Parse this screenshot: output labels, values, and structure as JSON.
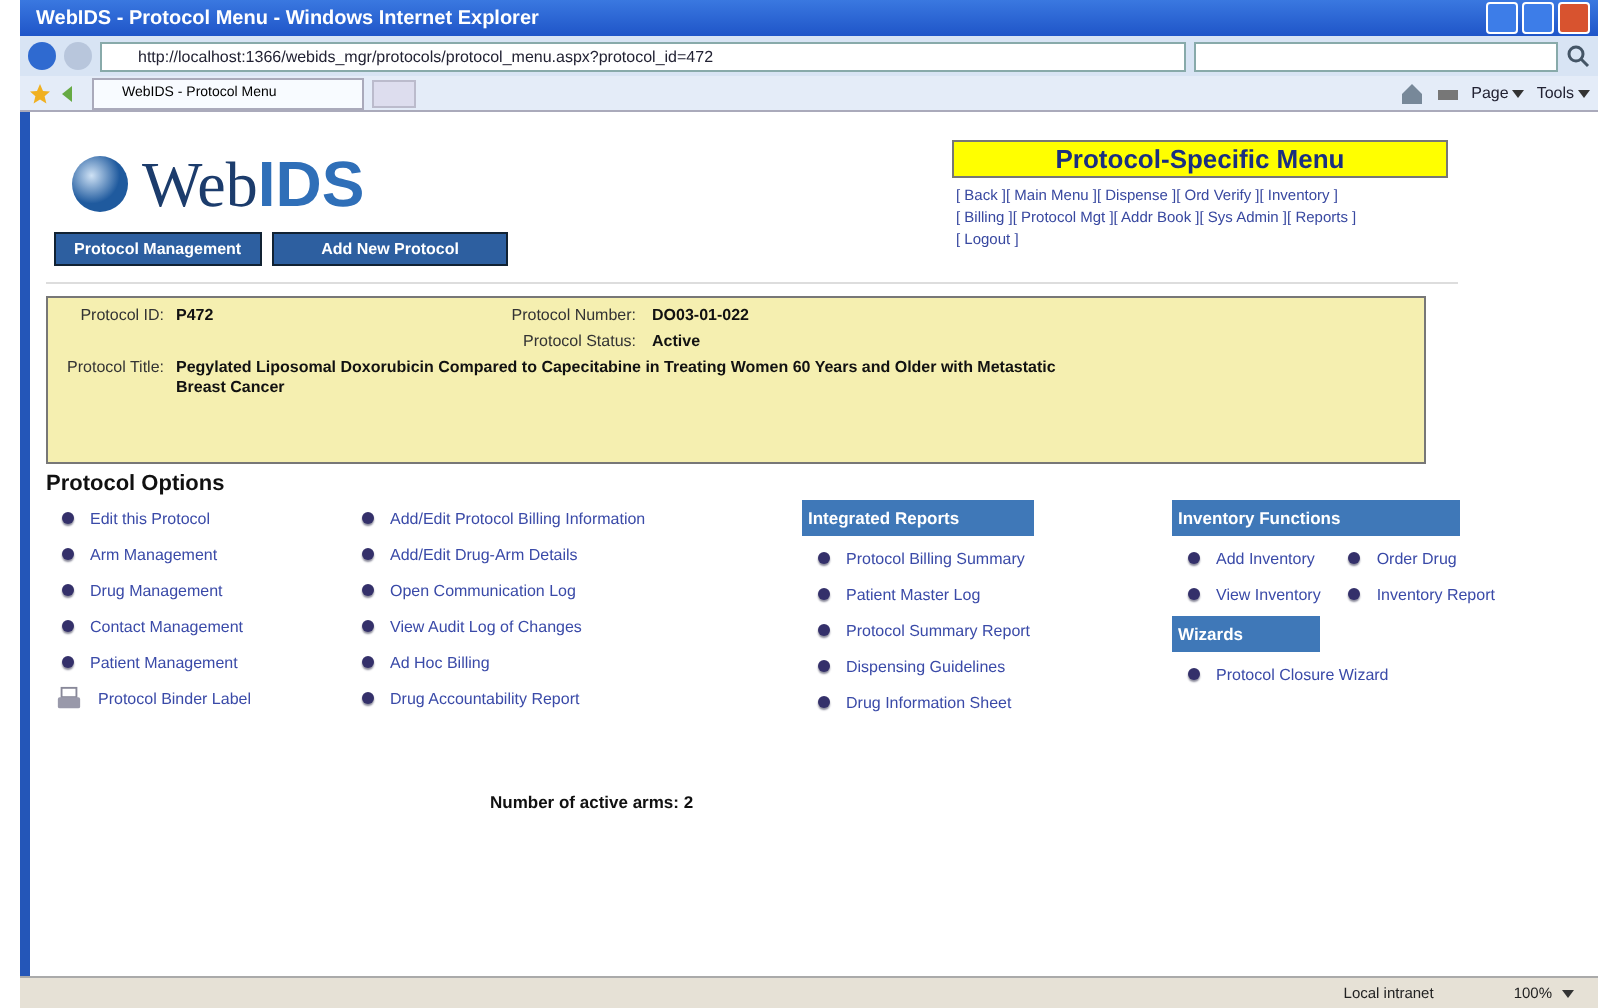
{
  "window": {
    "title": "WebIDS - Protocol Menu - Windows Internet Explorer"
  },
  "address_bar": {
    "url": "http://localhost:1366/webids_mgr/protocols/protocol_menu.aspx?protocol_id=472"
  },
  "browser_tab": {
    "title": "WebIDS - Protocol Menu"
  },
  "toolbar": [
    "Page",
    "Tools"
  ],
  "logo": {
    "light": "Web",
    "bold": "IDS"
  },
  "nav_buttons": [
    "Protocol Management",
    "Add New Protocol"
  ],
  "protocol_menu": {
    "title": "Protocol-Specific Menu",
    "links": [
      "[ Back ]",
      "[ Main Menu ]",
      "[ Dispense ]",
      "[ Ord Verify ]",
      "[ Inventory ]",
      "[ Billing ]",
      "[ Protocol Mgt ]",
      "[ Addr Book ]",
      "[ Sys Admin ]",
      "[ Reports ]",
      "[ Logout ]"
    ]
  },
  "protocol_info": {
    "id_label": "Protocol ID:",
    "id": "P472",
    "number_label": "Protocol Number:",
    "number": "DO03-01-022",
    "status_label": "Protocol Status:",
    "status": "Active",
    "title_label": "Protocol Title:",
    "title": "Pegylated Liposomal Doxorubicin Compared to Capecitabine in Treating Women 60 Years and Older with Metastatic Breast Cancer"
  },
  "options_heading": "Protocol Options",
  "options_column_1": [
    {
      "label": "Edit this Protocol",
      "kind": "bullet"
    },
    {
      "label": "Arm Management",
      "kind": "bullet"
    },
    {
      "label": "Drug Management",
      "kind": "bullet"
    },
    {
      "label": "Contact Management",
      "kind": "bullet"
    },
    {
      "label": "Patient Management",
      "kind": "bullet"
    },
    {
      "label": "Protocol Binder Label",
      "kind": "printer"
    }
  ],
  "options_column_2": [
    "Add/Edit Protocol Billing Information",
    "Add/Edit Drug-Arm Details",
    "Open Communication Log",
    "View Audit Log of Changes",
    "Ad Hoc Billing",
    "Drug Accountability Report"
  ],
  "integrated_reports": {
    "title": "Integrated Reports",
    "links": [
      "Protocol Billing Summary",
      "Patient Master Log",
      "Protocol Summary Report",
      "Dispensing Guidelines",
      "Drug Information Sheet"
    ]
  },
  "inventory_functions": {
    "title": "Inventory Functions",
    "links": [
      "Add Inventory",
      "Order Drug",
      "View Inventory",
      "Inventory Report"
    ]
  },
  "wizards": {
    "title": "Wizards",
    "links": [
      "Protocol Closure Wizard"
    ]
  },
  "active_arms": "Number of active arms: 2",
  "status_bar": {
    "zone": "Local intranet",
    "zoom": "100%"
  }
}
